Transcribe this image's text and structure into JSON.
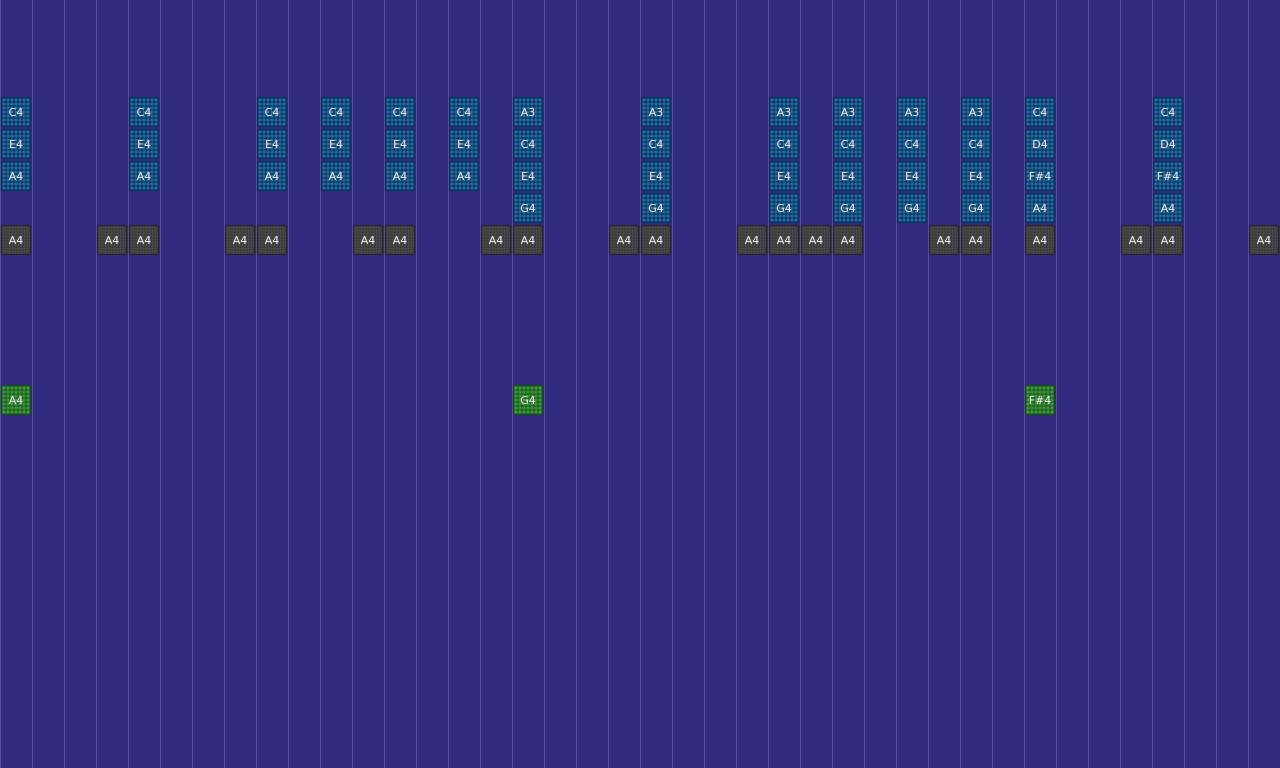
{
  "chord_notes": [
    [
      "C4",
      "E4",
      "A4"
    ],
    null,
    null,
    null,
    [
      "C4",
      "E4",
      "A4"
    ],
    null,
    null,
    null,
    [
      "C4",
      "E4",
      "A4"
    ],
    null,
    [
      "C4",
      "E4",
      "A4"
    ],
    null,
    [
      "C4",
      "E4",
      "A4"
    ],
    null,
    [
      "C4",
      "E4",
      "A4"
    ],
    null,
    [
      "A3",
      "C4",
      "E4",
      "G4"
    ],
    null,
    null,
    null,
    [
      "A3",
      "C4",
      "E4",
      "G4"
    ],
    null,
    null,
    null,
    [
      "A3",
      "C4",
      "E4",
      "G4"
    ],
    null,
    [
      "A3",
      "C4",
      "E4",
      "G4"
    ],
    null,
    [
      "A3",
      "C4",
      "E4",
      "G4"
    ],
    null,
    [
      "A3",
      "C4",
      "E4",
      "G4"
    ],
    null,
    [
      "C4",
      "D4",
      "F#4",
      "A4"
    ],
    null,
    null,
    null,
    [
      "C4",
      "D4",
      "F#4",
      "A4"
    ],
    null,
    null,
    null,
    null,
    null
  ],
  "bass_notes": [
    "A4",
    null,
    null,
    "A4",
    "A4",
    null,
    null,
    "A4",
    "A4",
    null,
    null,
    "A4",
    "A4",
    null,
    null,
    "A4",
    "A4",
    null,
    null,
    "A4",
    "A4",
    null,
    null,
    "A4",
    "A4",
    "A4",
    "A4",
    null,
    null,
    "A4",
    "A4",
    null,
    "A4",
    null,
    null,
    "A4",
    "A4",
    null,
    null,
    "A4"
  ],
  "lead_notes": [
    "A4",
    null,
    null,
    null,
    null,
    null,
    null,
    null,
    null,
    null,
    null,
    null,
    null,
    null,
    null,
    null,
    "G4",
    null,
    null,
    null,
    null,
    null,
    null,
    null,
    null,
    null,
    null,
    null,
    null,
    null,
    null,
    null,
    "F#4",
    null,
    null,
    null,
    null,
    null,
    null,
    null
  ]
}
